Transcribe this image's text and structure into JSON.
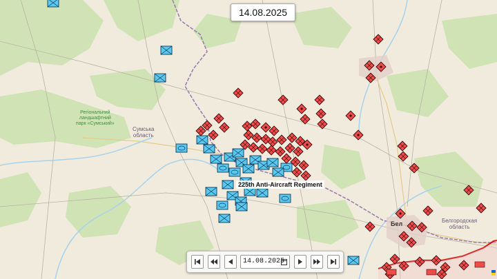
{
  "map": {
    "date_display": "14.08.2025",
    "unit_tooltip": "225th Anti-Aircraft Regiment",
    "labels": {
      "sumy_region": "Сумська\nобласть",
      "belgorod_region": "Белгородская\nобласть",
      "park": "Регіональний\nландшафтний\nпарк «Сумський»",
      "city_belgorod": "Бел"
    },
    "colors": {
      "ukraine_unit": "#5bc8ef",
      "russia_unit": "#ef4b4b",
      "front_line": "#d21b1b",
      "border": "#9b7fb0",
      "water": "#a6d2ee",
      "forest": "#cfe4b4"
    },
    "icons": {
      "ukraine_unit": "infantry-rectangle-icon",
      "russia_unit": "diamond-unit-icon"
    }
  },
  "timebar": {
    "date_value": "14.08.2025",
    "buttons": [
      "first-frame",
      "fast-backward",
      "step-backward",
      "play",
      "fast-forward",
      "last-frame"
    ]
  }
}
